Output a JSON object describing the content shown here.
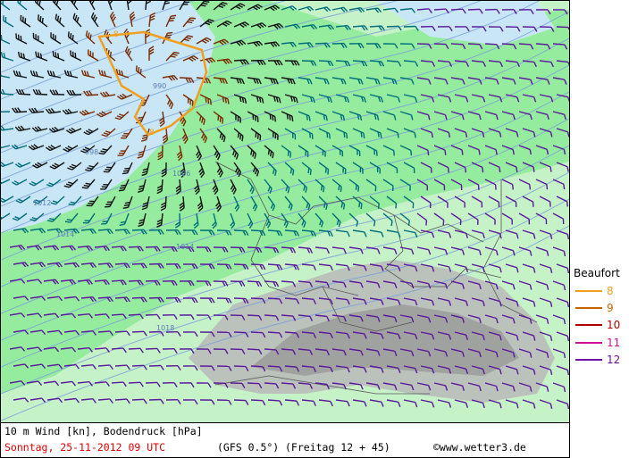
{
  "map": {
    "isobar_labels": [
      "1012",
      "1014",
      "1014",
      "1018",
      "990",
      "998",
      "1006"
    ],
    "low_marker": "",
    "colors": {
      "sea": "#c8e6f6",
      "land_low": "#96ec9e",
      "land_mid": "#c6f2c8",
      "alps": "#b8b8b8",
      "isobar": "#7aa0d8",
      "border": "#555555"
    }
  },
  "legend": {
    "title": "Beaufort",
    "items": [
      {
        "value": "8",
        "color": "#f0a020"
      },
      {
        "value": "9",
        "color": "#c86400"
      },
      {
        "value": "10",
        "color": "#b00000"
      },
      {
        "value": "11",
        "color": "#d0108c"
      },
      {
        "value": "12",
        "color": "#7010a8"
      }
    ]
  },
  "footer": {
    "variable": "10 m Wind [kn], Bodendruck [hPa]",
    "date": "Sonntag, 25-11-2012  09 UTC",
    "model": "(GFS 0.5°)",
    "run": "(Freitag 12 + 45)",
    "source": "©www.wetter3.de"
  }
}
